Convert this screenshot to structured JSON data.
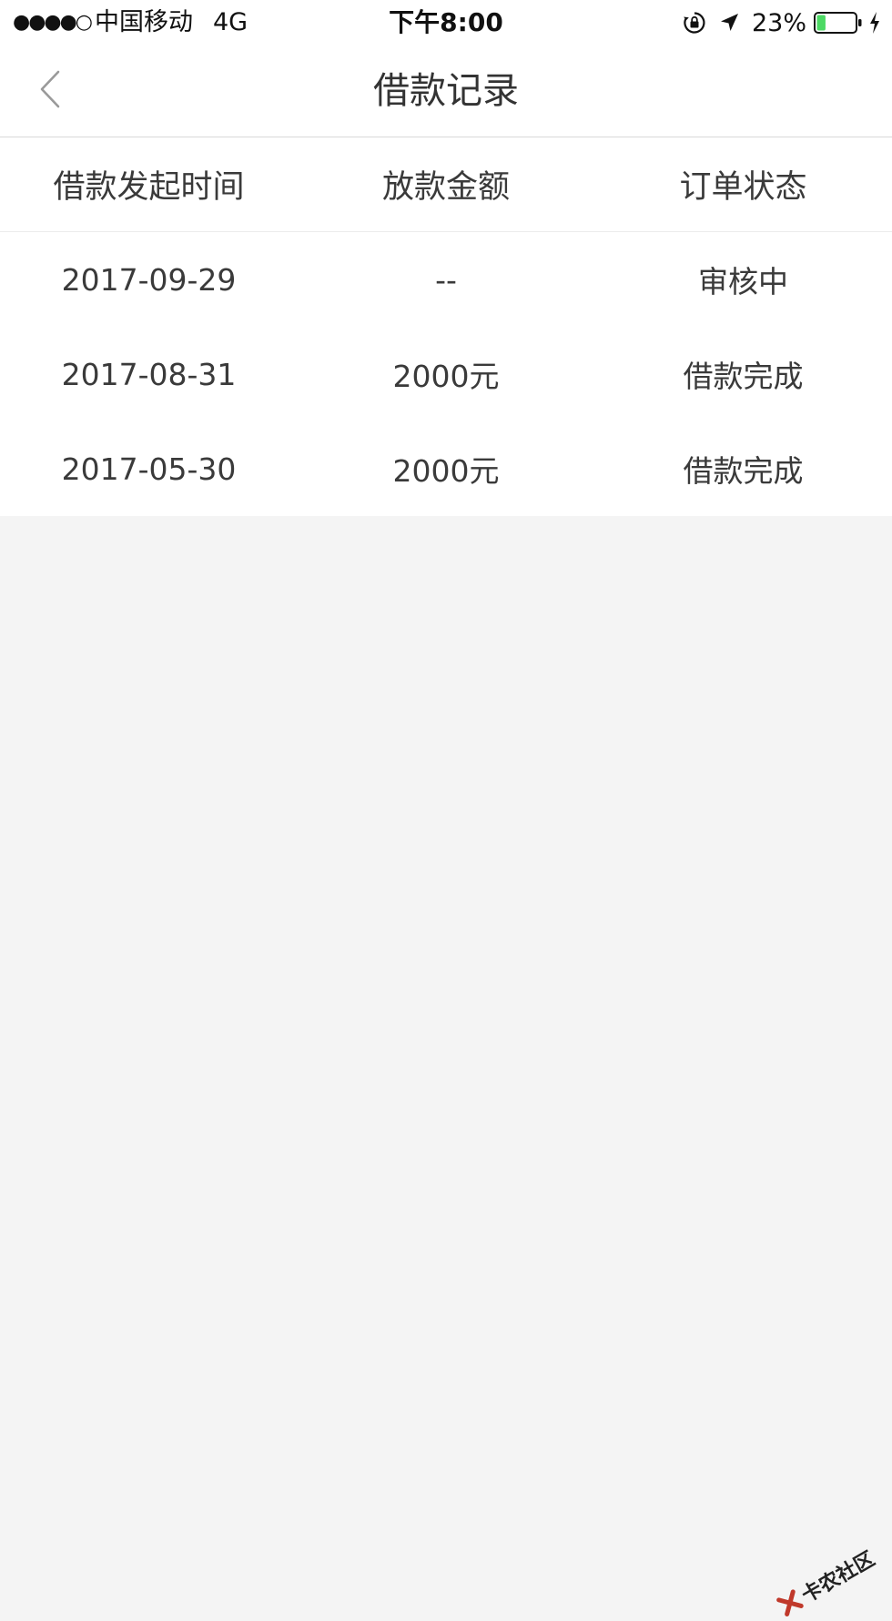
{
  "status_bar": {
    "signal": "●●●●○",
    "carrier": "中国移动",
    "network": "4G",
    "time": "下午8:00",
    "battery_percent": "23%",
    "battery_level": 0.23,
    "battery_color": "#4cd964",
    "icons": [
      "orientation-lock-icon",
      "location-arrow-icon",
      "battery-icon",
      "charging-bolt-icon"
    ]
  },
  "nav": {
    "back_icon": "chevron-left-icon",
    "title": "借款记录"
  },
  "table": {
    "headers": [
      "借款发起时间",
      "放款金额",
      "订单状态"
    ],
    "rows": [
      {
        "date": "2017-09-29",
        "amount": "--",
        "status": "审核中"
      },
      {
        "date": "2017-08-31",
        "amount": "2000元",
        "status": "借款完成"
      },
      {
        "date": "2017-05-30",
        "amount": "2000元",
        "status": "借款完成"
      }
    ]
  },
  "watermark": {
    "text": "卡农社区",
    "color": "#c0392b"
  }
}
